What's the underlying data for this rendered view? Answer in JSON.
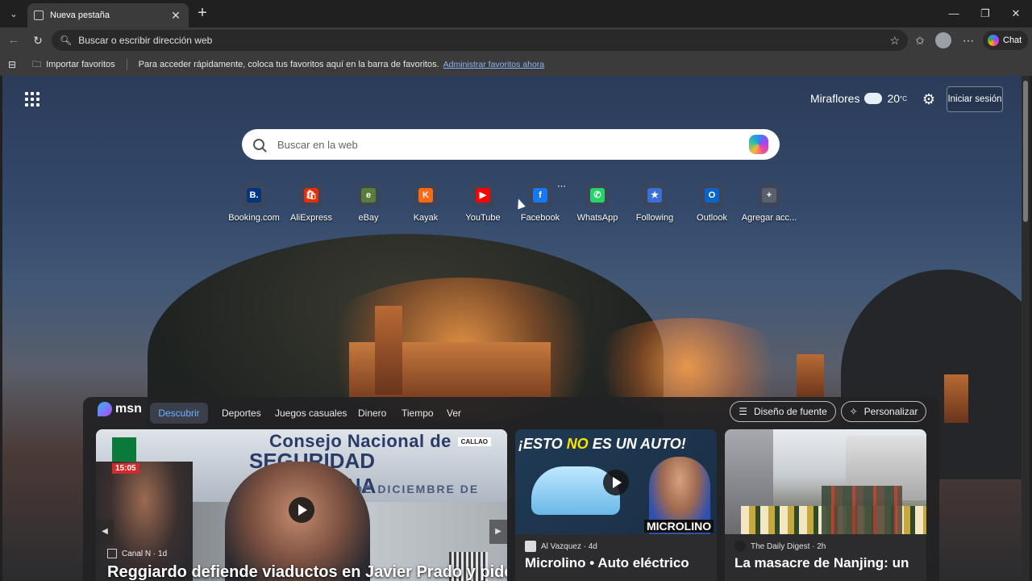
{
  "browser": {
    "tab_title": "Nueva pestaña",
    "address_placeholder": "Buscar o escribir dirección web",
    "chat_label": "Chat",
    "window_controls": {
      "minimize": "—",
      "maximize": "❐",
      "close": "✕"
    }
  },
  "favorites_bar": {
    "import_label": "Importar favoritos",
    "hint_text": "Para acceder rápidamente, coloca tus favoritos aquí en la barra de favoritos.",
    "manage_link": "Administrar favoritos ahora"
  },
  "newtab": {
    "weather": {
      "location": "Miraflores",
      "temp": "20",
      "unit": "°C"
    },
    "signin_label": "Iniciar sesión",
    "search_placeholder": "Buscar en la web",
    "quick_links": [
      {
        "label": "Booking.com",
        "icon": "booking-icon",
        "color": "#003580",
        "glyph": "B."
      },
      {
        "label": "AliExpress",
        "icon": "aliexpress-icon",
        "color": "#e62e04",
        "glyph": "🛍"
      },
      {
        "label": "eBay",
        "icon": "ebay-icon",
        "color": "#5a7d3a",
        "glyph": "e"
      },
      {
        "label": "Kayak",
        "icon": "kayak-icon",
        "color": "#ff690f",
        "glyph": "K"
      },
      {
        "label": "YouTube",
        "icon": "youtube-icon",
        "color": "#ff0000",
        "glyph": "▶"
      },
      {
        "label": "Facebook",
        "icon": "facebook-icon",
        "color": "#1877f2",
        "glyph": "f"
      },
      {
        "label": "WhatsApp",
        "icon": "whatsapp-icon",
        "color": "#25d366",
        "glyph": "✆"
      },
      {
        "label": "Following",
        "icon": "following-icon",
        "color": "#3b6fd8",
        "glyph": "★"
      },
      {
        "label": "Outlook",
        "icon": "outlook-icon",
        "color": "#0a64c8",
        "glyph": "O"
      },
      {
        "label": "Agregar acc...",
        "icon": "add-icon",
        "color": "#5a5f6a",
        "glyph": "+"
      }
    ]
  },
  "msn": {
    "logo_text": "msn",
    "tabs": [
      "Descubrir",
      "Deportes",
      "Juegos casuales",
      "Dinero",
      "Tiempo",
      "Ver"
    ],
    "font_design_label": "Diseño de fuente",
    "personalize_label": "Personalizar",
    "cards": [
      {
        "source": "Canal N",
        "age": "1d",
        "headline": "Reggiardo defiende viaductos en Javier Prado y pide",
        "overlay_time": "15:05",
        "overlay_tag": "CALLAO",
        "banner_line1": "Consejo Nacional de",
        "banner_line2": "SEGURIDAD CIUDADANA",
        "banner_line3": "DE DICIEMBRE DE"
      },
      {
        "source": "Al Vazquez",
        "age": "4d",
        "headline": "Microlino • Auto eléctrico",
        "thumb_text_pre": "¡ESTO ",
        "thumb_text_no": "NO",
        "thumb_text_post": " ES UN AUTO!",
        "thumb_brand": "MICROLINO"
      },
      {
        "source": "The Daily Digest",
        "age": "2h",
        "headline": "La masacre de Nanjing: un"
      }
    ]
  }
}
